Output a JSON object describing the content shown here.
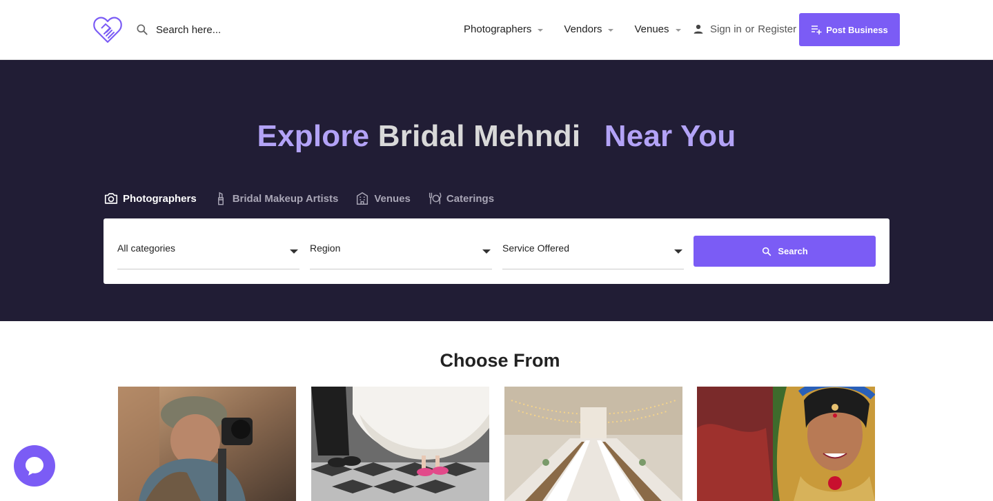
{
  "header": {
    "search_placeholder": "Search here...",
    "nav": [
      "Photographers",
      "Vendors",
      "Venues"
    ],
    "sign_in": "Sign in",
    "or": "or",
    "register": "Register",
    "post_business": "Post Business"
  },
  "hero": {
    "title_part1": "Explore",
    "title_part2": "Bridal Mehndi",
    "title_part3": "Near You",
    "tabs": [
      "Photographers",
      "Bridal Makeup Artists",
      "Venues",
      "Caterings"
    ],
    "filters": [
      "All categories",
      "Region",
      "Service Offered"
    ],
    "search_label": "Search"
  },
  "choose": {
    "title": "Choose From"
  },
  "colors": {
    "accent": "#7b5cf5",
    "hero_bg": "#211d35",
    "hero_highlight": "#b3a3f7"
  }
}
